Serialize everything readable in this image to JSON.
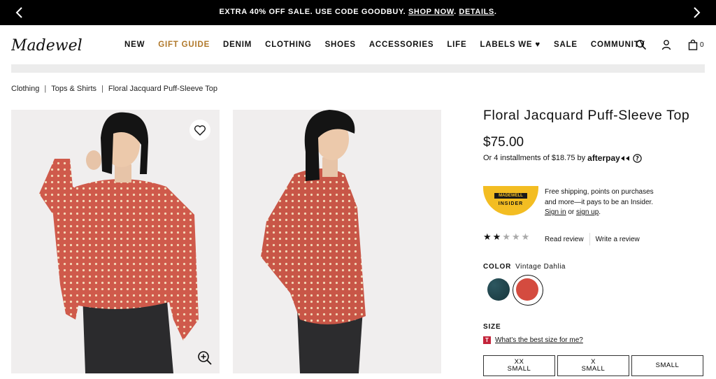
{
  "promo": {
    "text": "EXTRA 40% OFF SALE. USE CODE GOODBUY.",
    "shop_link": "SHOP NOW",
    "details_link": "DETAILS",
    "prev_icon": "chevron-left-icon",
    "next_icon": "chevron-right-icon"
  },
  "header": {
    "logo": "Madewell",
    "nav": [
      "NEW",
      "GIFT GUIDE",
      "DENIM",
      "CLOTHING",
      "SHOES",
      "ACCESSORIES",
      "LIFE",
      "LABELS WE ♥",
      "SALE",
      "COMMUNITY"
    ],
    "gift_guide_color": "#b0782a",
    "icons": [
      "search-icon",
      "account-icon",
      "bag-icon"
    ],
    "bag_count": "0"
  },
  "breadcrumb": [
    "Clothing",
    "Tops & Shirts",
    "Floral Jacquard Puff-Sleeve Top"
  ],
  "product": {
    "title": "Floral Jacquard Puff-Sleeve Top",
    "price": "$75.00",
    "installments": "Or 4 installments of $18.75 by",
    "afterpay": "afterpay",
    "afterpay_info_icon": "info-icon",
    "rating": 2,
    "rating_max": 5,
    "read_review": "Read review",
    "write_review": "Write a review",
    "color_label": "COLOR",
    "color_value": "Vintage Dahlia",
    "swatches": [
      {
        "name": "dark-teal",
        "color": "#1e4248"
      },
      {
        "name": "vintage-dahlia",
        "color": "#d44b3f",
        "selected": true
      }
    ],
    "size_label": "SIZE",
    "size_help": "What's the best size for me?",
    "sizes": [
      "XX\nSMALL",
      "X\nSMALL",
      "SMALL"
    ]
  },
  "insider": {
    "badge_top": "MADEWELL",
    "badge_bottom": "INSIDER",
    "text": "Free shipping, points on purchases and more—it pays to be an Insider.",
    "sign_in": "Sign in",
    "or": "or",
    "sign_up": "sign up",
    "badge_color": "#f3bd22"
  }
}
